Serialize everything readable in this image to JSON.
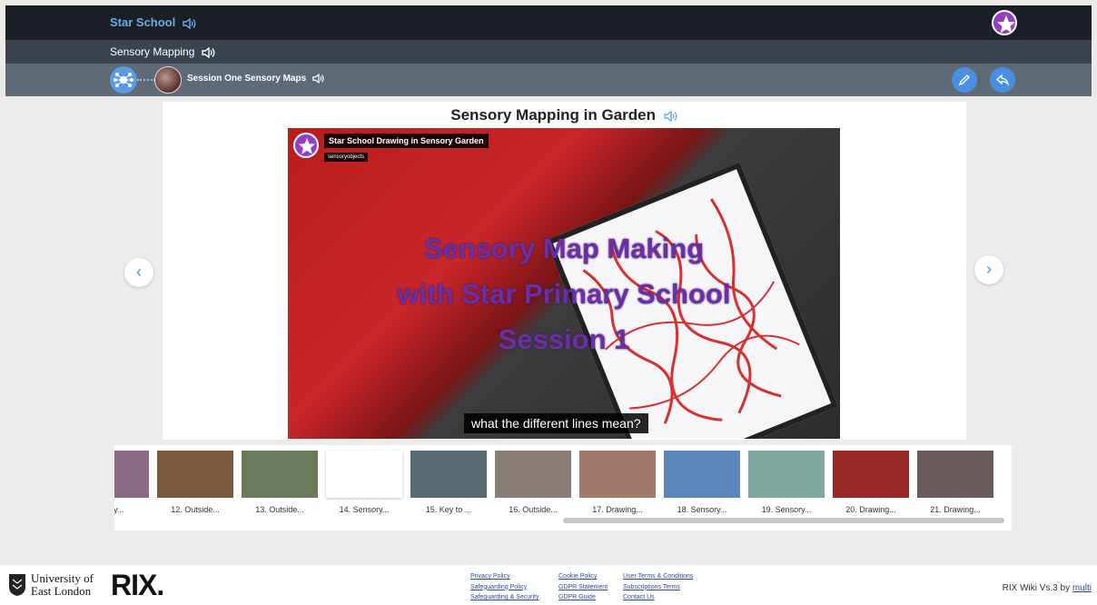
{
  "header": {
    "site_title": "Star School",
    "page_title": "Sensory Mapping",
    "session_title": "Session One Sensory Maps"
  },
  "content": {
    "heading": "Sensory Mapping in Garden",
    "video": {
      "title": "Star School Drawing in Sensory Garden",
      "channel": "sensoryobjects",
      "overlay_lines": [
        "Sensory Map Making",
        "with Star Primary School",
        "Session 1"
      ],
      "caption": "what the different lines mean?"
    }
  },
  "thumbnails": [
    {
      "label": "nsory...",
      "color": "#8a6a80"
    },
    {
      "label": "12. Outside...",
      "color": "#7a5a40"
    },
    {
      "label": "13. Outside...",
      "color": "#6a7a5a"
    },
    {
      "label": "14. Sensory...",
      "color": "#ffffff"
    },
    {
      "label": "15. Key to ...",
      "color": "#5a6a72"
    },
    {
      "label": "16. Outside...",
      "color": "#8a7e7a"
    },
    {
      "label": "17. Drawing...",
      "color": "#a07868"
    },
    {
      "label": "18. Sensory...",
      "color": "#5b86b8"
    },
    {
      "label": "19. Sensory...",
      "color": "#7ea8a0"
    },
    {
      "label": "20. Drawing...",
      "color": "#9a2a2a"
    },
    {
      "label": "21. Drawing...",
      "color": "#6a5a5a"
    }
  ],
  "footer": {
    "university_line1": "University of",
    "university_line2": "East London",
    "brand": "RIX.",
    "links": {
      "privacy": "Privacy Policy",
      "safeguarding_policy": "Safeguarding Policy",
      "safeguarding_security": "Safeguarding & Security",
      "cookie": "Cookie Policy",
      "gdpr_statement": "GDPR Statement",
      "gdpr_guide": "GDPR Guide",
      "terms": "User Terms & Conditions",
      "subscriptions": "Subscriptions Terms",
      "contact": "Contact Us"
    },
    "version_text": "RIX Wiki Vs.3 by ",
    "version_link": "multi"
  },
  "colors": {
    "accent": "#4a90e2",
    "brand_purple": "#9140c0",
    "header_dark": "#1b1f26"
  }
}
